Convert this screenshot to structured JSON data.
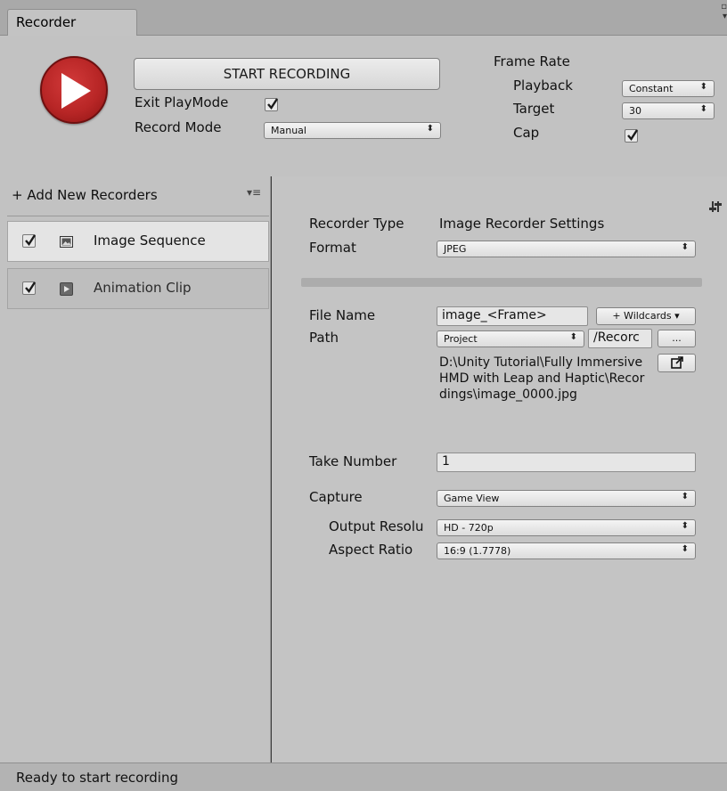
{
  "window": {
    "tab_title": "Recorder",
    "window_buttons": "▫ ×\n▾≡"
  },
  "header": {
    "start_button": "START RECORDING",
    "exit_playmode_label": "Exit PlayMode",
    "exit_playmode_checked": true,
    "record_mode_label": "Record Mode",
    "record_mode_value": "Manual",
    "frame_rate_label": "Frame Rate",
    "playback_label": "Playback",
    "playback_value": "Constant",
    "target_label": "Target",
    "target_value": "30",
    "cap_label": "Cap",
    "cap_checked": true
  },
  "left_panel": {
    "add_recorders": "+ Add New Recorders",
    "menu_icon": "▾≡",
    "recorders": [
      {
        "label": "Image Sequence",
        "enabled": true,
        "selected": true,
        "icon": "image-icon"
      },
      {
        "label": "Animation Clip",
        "enabled": true,
        "selected": false,
        "icon": "animation-icon"
      }
    ]
  },
  "settings": {
    "recorder_type_label": "Recorder Type",
    "recorder_type_value": "Image Recorder Settings",
    "format_label": "Format",
    "format_value": "JPEG",
    "file_name_label": "File Name",
    "file_name_value": "image_<Frame>",
    "wildcards_button": "+ Wildcards",
    "path_label": "Path",
    "path_root_value": "Project",
    "path_sub_value": "/Recorc",
    "browse_button": "...",
    "resolved_path": "D:\\Unity Tutorial\\Fully Immersive HMD with Leap and Haptic\\Recordings\\image_0000.jpg",
    "take_number_label": "Take Number",
    "take_number_value": "1",
    "capture_label": "Capture",
    "capture_value": "Game View",
    "output_resolution_label": "Output Resolu",
    "output_resolution_value": "HD - 720p",
    "aspect_ratio_label": "Aspect Ratio",
    "aspect_ratio_value": "16:9 (1.7778)"
  },
  "status_bar": {
    "text": "Ready to start recording"
  },
  "colors": {
    "panel": "#c2c2c2",
    "play_button": "#b82626",
    "selected_item": "#e4e4e4"
  }
}
